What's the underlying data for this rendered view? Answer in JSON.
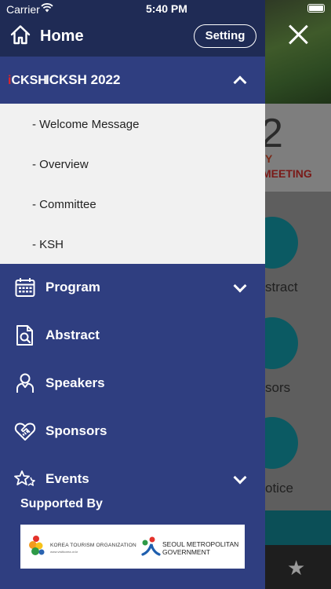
{
  "status_bar": {
    "carrier": "Carrier",
    "time": "5:40 PM"
  },
  "header": {
    "home_label": "Home",
    "setting_label": "Setting"
  },
  "section": {
    "logo_mark": "i",
    "logo_text": "CKSH",
    "title": "ICKSH 2022",
    "expanded": true,
    "items": [
      "- Welcome Message",
      "- Overview",
      "- Committee",
      "- KSH"
    ]
  },
  "menu": [
    {
      "label": "Program",
      "icon": "calendar-icon",
      "has_chevron": true
    },
    {
      "label": "Abstract",
      "icon": "document-search-icon",
      "has_chevron": false
    },
    {
      "label": "Speakers",
      "icon": "person-icon",
      "has_chevron": false
    },
    {
      "label": "Sponsors",
      "icon": "handshake-heart-icon",
      "has_chevron": false
    },
    {
      "label": "Events",
      "icon": "stars-icon",
      "has_chevron": true
    }
  ],
  "supported": {
    "heading": "Supported By",
    "kto_name": "KOREA TOURISM ORGANIZATION",
    "kto_url": "www.visitkorea.or.kr",
    "seoul_line1": "SEOUL METROPOLITAN",
    "seoul_line2": "GOVERNMENT"
  },
  "background_app": {
    "big_digit": "2",
    "word_fragment_1": "Y",
    "word_fragment_2": "MEETING",
    "labels": [
      "stract",
      "sors",
      "otice"
    ]
  },
  "colors": {
    "drawer_bg": "#2f3e80",
    "header_bg": "#1f2b55",
    "submenu_bg": "#f1f1f1",
    "logo_accent": "#e2232a"
  }
}
